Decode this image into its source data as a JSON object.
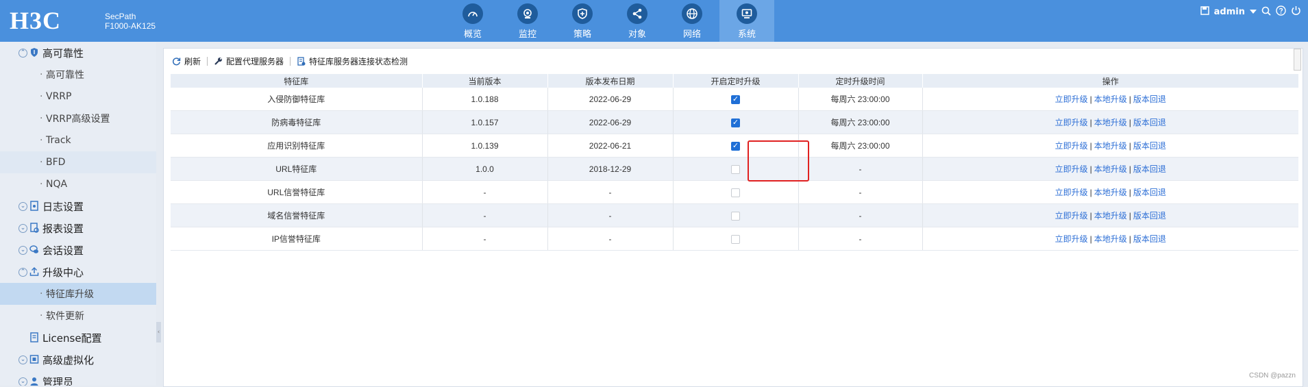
{
  "header": {
    "logo": "H3C",
    "product_line1": "SecPath",
    "product_line2": "F1000-AK125",
    "nav": [
      {
        "label": "概览",
        "icon": "dashboard-icon"
      },
      {
        "label": "监控",
        "icon": "monitor-icon"
      },
      {
        "label": "策略",
        "icon": "shield-icon"
      },
      {
        "label": "对象",
        "icon": "share-nodes-icon"
      },
      {
        "label": "网络",
        "icon": "globe-icon"
      },
      {
        "label": "系统",
        "icon": "system-screen-icon",
        "active": true
      }
    ],
    "user": "admin"
  },
  "sidebar": {
    "items": [
      {
        "label": "高可靠性",
        "type": "group"
      },
      {
        "label": "高可靠性",
        "type": "sub"
      },
      {
        "label": "VRRP",
        "type": "sub"
      },
      {
        "label": "VRRP高级设置",
        "type": "sub"
      },
      {
        "label": "Track",
        "type": "sub"
      },
      {
        "label": "BFD",
        "type": "sub"
      },
      {
        "label": "NQA",
        "type": "sub"
      },
      {
        "label": "日志设置",
        "type": "group"
      },
      {
        "label": "报表设置",
        "type": "group"
      },
      {
        "label": "会话设置",
        "type": "group"
      },
      {
        "label": "升级中心",
        "type": "group"
      },
      {
        "label": "特征库升级",
        "type": "sub"
      },
      {
        "label": "软件更新",
        "type": "sub"
      },
      {
        "label": "License配置",
        "type": "group"
      },
      {
        "label": "高级虚拟化",
        "type": "group"
      },
      {
        "label": "管理员",
        "type": "group"
      }
    ]
  },
  "toolbar": {
    "refresh": "刷新",
    "proxy": "配置代理服务器",
    "check": "特征库服务器连接状态检测"
  },
  "table": {
    "headers": [
      "特征库",
      "当前版本",
      "版本发布日期",
      "开启定时升级",
      "定时升级时间",
      "操作"
    ],
    "rows": [
      {
        "name": "入侵防御特征库",
        "version": "1.0.188",
        "date": "2022-06-29",
        "scheduled": true,
        "time": "每周六 23:00:00"
      },
      {
        "name": "防病毒特征库",
        "version": "1.0.157",
        "date": "2022-06-29",
        "scheduled": true,
        "time": "每周六 23:00:00"
      },
      {
        "name": "应用识别特征库",
        "version": "1.0.139",
        "date": "2022-06-21",
        "scheduled": true,
        "time": "每周六 23:00:00"
      },
      {
        "name": "URL特征库",
        "version": "1.0.0",
        "date": "2018-12-29",
        "scheduled": false,
        "time": "-"
      },
      {
        "name": "URL信誉特征库",
        "version": "-",
        "date": "-",
        "scheduled": false,
        "time": "-"
      },
      {
        "name": "域名信誉特征库",
        "version": "-",
        "date": "-",
        "scheduled": false,
        "time": "-"
      },
      {
        "name": "IP信誉特征库",
        "version": "-",
        "date": "-",
        "scheduled": false,
        "time": "-"
      }
    ],
    "ops": {
      "upgrade_now": "立即升级",
      "local_upgrade": "本地升级",
      "rollback": "版本回退",
      "separator": "|"
    }
  },
  "watermark": "CSDN @pazzn",
  "colors": {
    "header": "#4a90dd",
    "active_nav": "#6ba6e6",
    "link": "#2d6fd6",
    "highlight_box": "#e02020"
  }
}
